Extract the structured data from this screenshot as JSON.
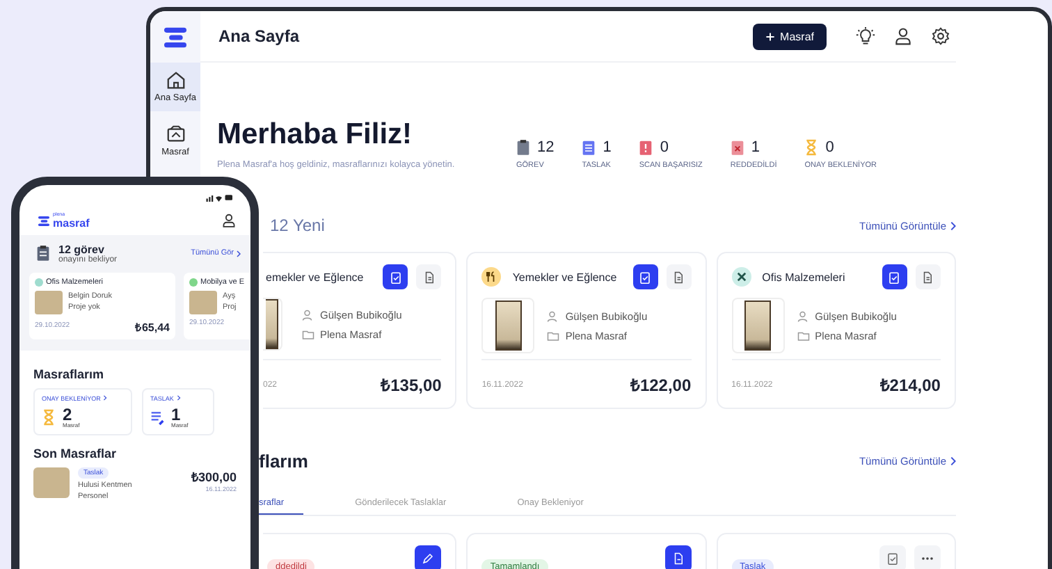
{
  "desktop": {
    "sidebar": {
      "items": [
        {
          "label": "Ana Sayfa",
          "kind": "home",
          "selected": true
        },
        {
          "label": "Masraf",
          "kind": "receipt",
          "selected": false
        }
      ]
    },
    "header": {
      "title": "Ana Sayfa",
      "button": "Masraf"
    },
    "greeting": {
      "title": "Merhaba Filiz!",
      "subtitle": "Plena Masraf'a hoş geldiniz, masraflarınızı kolayca yönetin."
    },
    "stats": [
      {
        "value": "12",
        "label": "GÖREV",
        "kind": "task"
      },
      {
        "value": "1",
        "label": "TASLAK",
        "kind": "draft"
      },
      {
        "value": "0",
        "label": "SCAN BAŞARISIZ",
        "kind": "failed"
      },
      {
        "value": "1",
        "label": "REDDEDİLDİ",
        "kind": "rejected"
      },
      {
        "value": "0",
        "label": "ONAY BEKLENİYOR",
        "kind": "pending"
      }
    ],
    "pending": {
      "title": "12 Yeni",
      "link": "Tümünü Görüntüle",
      "cards": [
        {
          "category": "emekler ve Eğlence",
          "user": "Gülşen Bubikoğlu",
          "project": "Plena Masraf",
          "date": "022",
          "amount": "₺135,00"
        },
        {
          "category": "Yemekler ve Eğlence",
          "kind": "food",
          "color": "#fcd98a",
          "user": "Gülşen Bubikoğlu",
          "project": "Plena Masraf",
          "date": "16.11.2022",
          "amount": "₺122,00"
        },
        {
          "category": "Ofis Malzemeleri",
          "kind": "office",
          "color": "#cdeee8",
          "user": "Gülşen Bubikoğlu",
          "project": "Plena Masraf",
          "date": "16.11.2022",
          "amount": "₺214,00"
        }
      ]
    },
    "expenses": {
      "title": "flarım",
      "link": "Tümünü Görüntüle",
      "tabs": [
        {
          "label": "sraflar",
          "selected": true
        },
        {
          "label": "Gönderilecek Taslaklar",
          "selected": false
        },
        {
          "label": "Onay Bekleniyor",
          "selected": false
        }
      ],
      "cards": [
        {
          "status": "ddedildi",
          "kind": "rejected",
          "actions": [
            {
              "kind": "edit",
              "primary": true
            }
          ]
        },
        {
          "status": "Tamamlandı",
          "kind": "done",
          "actions": [
            {
              "kind": "document",
              "primary": true
            }
          ]
        },
        {
          "status": "Taslak",
          "kind": "draft",
          "actions": [
            {
              "kind": "clipboard",
              "primary": false
            },
            {
              "kind": "more",
              "primary": false
            }
          ]
        }
      ]
    }
  },
  "phone": {
    "logo": {
      "small": "plena",
      "main": "masraf"
    },
    "tasks": {
      "title": "12 görev",
      "subtitle": "onayını bekliyor",
      "link": "Tümünü Gör"
    },
    "cards": [
      {
        "category": "Ofis Malzemeleri",
        "color": "#9fdccf",
        "user": "Belgin Doruk",
        "project": "Proje yok",
        "date": "29.10.2022",
        "amount": "₺65,44"
      },
      {
        "category": "Mobilya ve E",
        "color": "#7fd68a",
        "user": "Ayş",
        "project": "Proj",
        "date": "29.10.2022"
      }
    ],
    "summary": {
      "title": "Masraflarım",
      "items": [
        {
          "label": "ONAY BEKLENİYOR",
          "value": "2",
          "unit": "Masraf",
          "kind": "pending"
        },
        {
          "label": "TASLAK",
          "value": "1",
          "unit": "Masraf",
          "kind": "draft"
        }
      ]
    },
    "recent": {
      "title": "Son Masraflar",
      "items": [
        {
          "status": "Taslak",
          "user": "Hulusi Kentmen",
          "project": "Personel",
          "amount": "₺300,00",
          "date": "16.11.2022"
        }
      ]
    }
  }
}
